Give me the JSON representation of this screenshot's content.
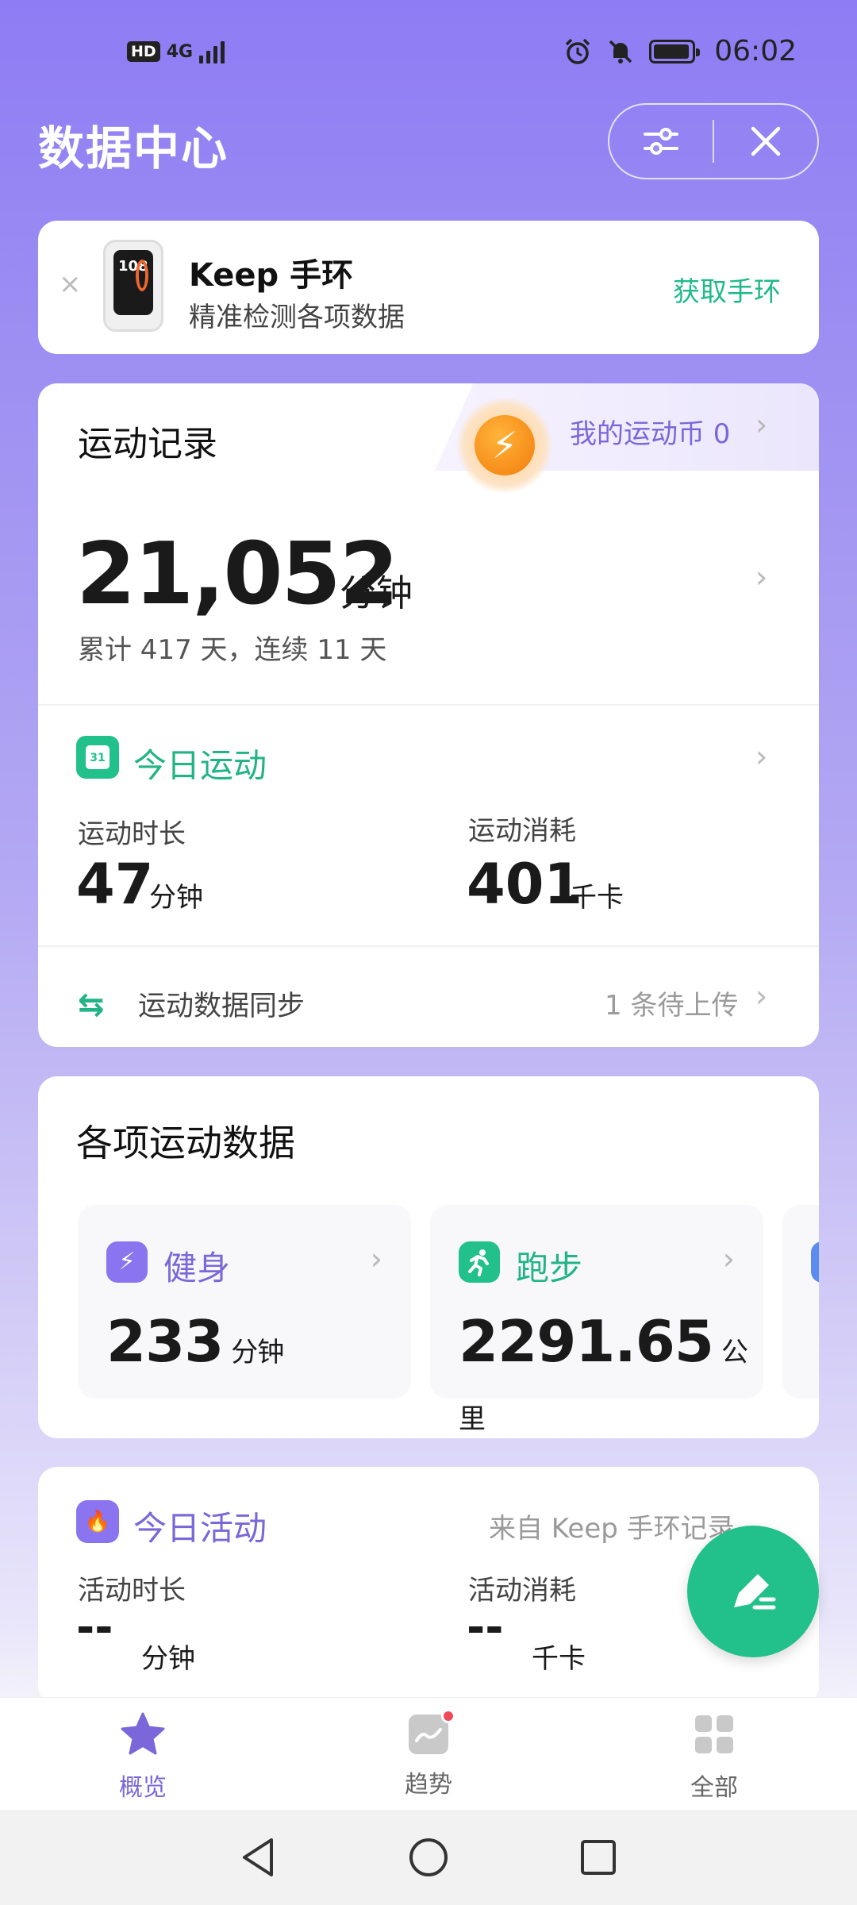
{
  "status_bar": {
    "hd": "HD",
    "network": "4G",
    "time": "06:02"
  },
  "header": {
    "title": "数据中心"
  },
  "promo": {
    "close": "×",
    "band_screen": "108",
    "title": "Keep 手环",
    "subtitle": "精准检测各项数据",
    "cta": "获取手环"
  },
  "record": {
    "title": "运动记录",
    "coins_label": "我的运动币 0",
    "total_value": "21,052",
    "total_unit": "分钟",
    "summary": "累计 417 天，连续 11 天",
    "today": {
      "calendar_day": "31",
      "title": "今日运动",
      "duration_label": "运动时长",
      "duration_value": "47",
      "duration_unit": "分钟",
      "calories_label": "运动消耗",
      "calories_value": "401",
      "calories_unit": "千卡"
    },
    "sync": {
      "icon": "⇆",
      "label": "运动数据同步",
      "status": "1 条待上传"
    }
  },
  "sports": {
    "title": "各项运动数据",
    "tiles": [
      {
        "name": "健身",
        "value": "233",
        "unit": "分钟",
        "icon": "bolt-icon",
        "color": "#8b74f0"
      },
      {
        "name": "跑步",
        "value": "2291.65",
        "unit": "公里",
        "icon": "runner-icon",
        "color": "#22c08a"
      }
    ]
  },
  "activity": {
    "title": "今日活动",
    "source": "来自 Keep 手环记录",
    "duration_label": "活动时长",
    "duration_value": "--",
    "duration_unit": "分钟",
    "calories_label": "活动消耗",
    "calories_value": "--",
    "calories_unit": "千卡"
  },
  "bottom_nav": {
    "items": [
      {
        "label": "概览",
        "active": true
      },
      {
        "label": "趋势",
        "active": false
      },
      {
        "label": "全部",
        "active": false
      }
    ]
  },
  "colors": {
    "accent_purple": "#7b67d9",
    "accent_green": "#22c08a",
    "badge_red": "#f04a5a"
  }
}
